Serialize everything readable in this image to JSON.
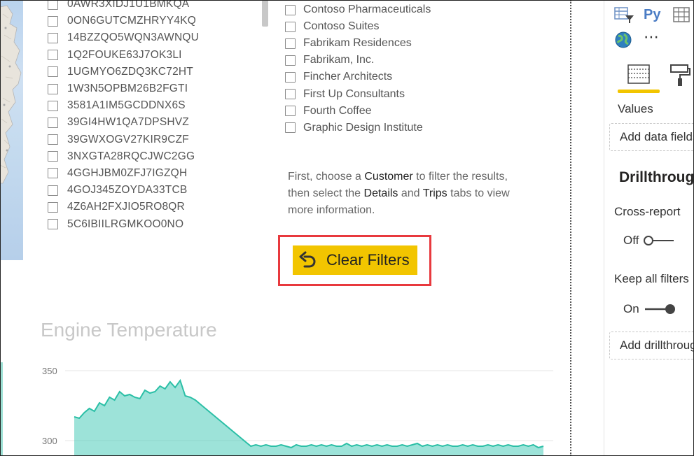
{
  "id_slicer": {
    "items": [
      "0AWR3XIDJ1U1BMKQA",
      "0ON6GUTCMZHRYY4KQ",
      "14BZZQO5WQN3AWNQU",
      "1Q2FOUKE63J7OK3LI",
      "1UGMYO6ZDQ3KC72HT",
      "1W3N5OPBM26B2FGTI",
      "3581A1IM5GCDDNX6S",
      "39GI4HW1QA7DPSHVZ",
      "39GWXOGV27KIR9CZF",
      "3NXGTA28RQCJWC2GG",
      "4GGHJBM0ZFJ7IGZQH",
      "4GOJ345ZOYDA33TCB",
      "4Z6AH2FXJIO5RO8QR",
      "5C6IBIILRGMKOO0NO"
    ]
  },
  "customer_slicer": {
    "items": [
      "Contoso Pharmaceuticals",
      "Contoso Suites",
      "Fabrikam Residences",
      "Fabrikam, Inc.",
      "Fincher Architects",
      "First Up Consultants",
      "Fourth Coffee",
      "Graphic Design Institute"
    ]
  },
  "instructions": {
    "p1": "First, choose a ",
    "customer": "Customer",
    "p2": " to filter the results, then select the ",
    "details": "Details",
    "p3": " and ",
    "trips": "Trips",
    "p4": " tabs to view more information."
  },
  "clear_filters": {
    "label": "Clear Filters",
    "icon": "undo-arrow-icon",
    "highlight_color": "#e8393e",
    "button_color": "#f2c500"
  },
  "chart_data": {
    "type": "area",
    "title": "Engine Temperature",
    "xlabel": "",
    "ylabel": "",
    "yticks": [
      350,
      300
    ],
    "ylim": [
      290,
      360
    ],
    "color": "#3cc7b3",
    "y": [
      317,
      316,
      320,
      323,
      321,
      327,
      325,
      331,
      329,
      335,
      332,
      333,
      331,
      330,
      336,
      334,
      335,
      339,
      337,
      342,
      338,
      343,
      332,
      331,
      329,
      326,
      323,
      320,
      317,
      314,
      311,
      308,
      305,
      302,
      299,
      296,
      297,
      296,
      297,
      296,
      296,
      297,
      296,
      295,
      297,
      296,
      296,
      297,
      296,
      297,
      296,
      297,
      296,
      296,
      298,
      296,
      297,
      296,
      297,
      296,
      297,
      296,
      297,
      296,
      296,
      297,
      296,
      297,
      298,
      296,
      297,
      296,
      297,
      296,
      297,
      296,
      296,
      297,
      296,
      297,
      296,
      296,
      297,
      296,
      297,
      296,
      297,
      296,
      296,
      297,
      296,
      297,
      295,
      296
    ]
  },
  "visualizations_pane": {
    "py_label": "Py",
    "more": "⋯",
    "icons": [
      "table-filter-icon",
      "python-visual-icon",
      "table-icon",
      "globe-icon",
      "fields-tab-icon",
      "format-paint-icon"
    ],
    "values_label": "Values",
    "add_data_fields": "Add data fields here",
    "drillthrough_heading": "Drillthrough",
    "cross_report_label": "Cross-report",
    "cross_report_state": "Off",
    "keep_filters_label": "Keep all filters",
    "keep_filters_state": "On",
    "add_drillthrough": "Add drillthrough fields here"
  }
}
